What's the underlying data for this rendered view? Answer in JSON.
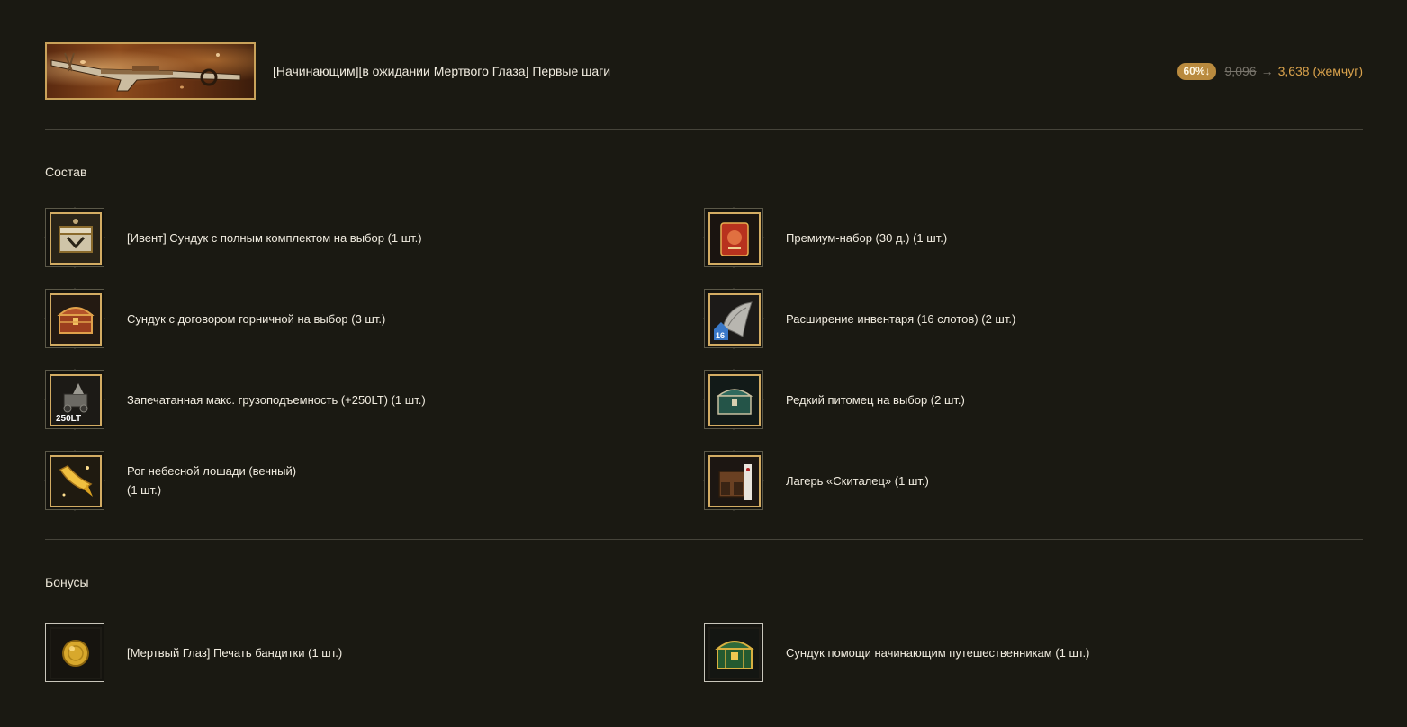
{
  "header": {
    "title": "[Начинающим][в ожидании Мертвого Глаза] Первые шаги",
    "discount": "60%↓",
    "price_old": "9,096",
    "arrow": "→",
    "price_new": "3,638 (жемчуг)"
  },
  "sections": {
    "contents_title": "Состав",
    "bonuses_title": "Бонусы"
  },
  "contents": {
    "left": [
      {
        "label": "[Ивент] Сундук с полным комплектом на выбор (1 шт.)",
        "icon": "event-chest-icon"
      },
      {
        "label": "Сундук с договором горничной на выбор (3 шт.)",
        "icon": "maid-contract-chest-icon"
      },
      {
        "label": "Запечатанная макс. грузоподъемность (+250LT) (1 шт.)",
        "icon": "weight-limit-icon",
        "icon_text": "250LT"
      },
      {
        "label_line1": "Рог небесной лошади (вечный)",
        "label_line2": "(1 шт.)",
        "icon": "horn-icon"
      }
    ],
    "right": [
      {
        "label": "Премиум-набор (30 д.) (1 шт.)",
        "icon": "premium-set-icon"
      },
      {
        "label": "Расширение инвентаря (16 слотов) (2 шт.)",
        "icon": "inventory-expansion-icon",
        "icon_text": "16"
      },
      {
        "label": "Редкий питомец на выбор (2 шт.)",
        "icon": "pet-chest-icon"
      },
      {
        "label": "Лагерь «Скиталец» (1 шт.)",
        "icon": "camp-icon"
      }
    ]
  },
  "bonuses": [
    {
      "label": "[Мертвый Глаз] Печать бандитки (1 шт.)",
      "icon": "gold-seal-icon"
    },
    {
      "label": "Сундук помощи начинающим путешественникам (1 шт.)",
      "icon": "traveler-chest-icon"
    }
  ]
}
